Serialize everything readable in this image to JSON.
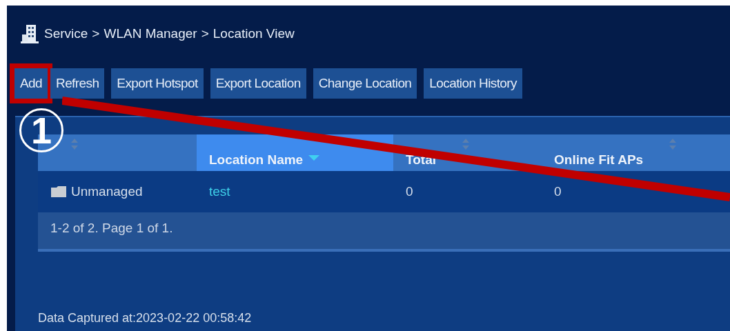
{
  "breadcrumb": [
    "Service",
    "WLAN Manager",
    "Location View"
  ],
  "breadcrumb_separator": ">",
  "toolbar": [
    {
      "label": "Add",
      "highlighted": true
    },
    {
      "label": "Refresh",
      "highlighted": false
    },
    {
      "label": "Export Hotspot",
      "highlighted": false
    },
    {
      "label": "Export Location",
      "highlighted": false
    },
    {
      "label": "Change Location",
      "highlighted": false
    },
    {
      "label": "Location History",
      "highlighted": false
    }
  ],
  "callout": {
    "number": "1"
  },
  "table": {
    "columns": [
      {
        "selected": false
      },
      {
        "label": "Location Name",
        "selected": true
      },
      {
        "label": "Total",
        "selected": false
      },
      {
        "label": "Online Fit APs",
        "selected": false
      }
    ],
    "rows": [
      {
        "group": "Unmanaged",
        "name": "test",
        "total": "0",
        "online": "0"
      }
    ],
    "pager": "1-2 of 2. Page 1 of 1."
  },
  "status": "Data Captured at:2023-02-22 00:58:42"
}
